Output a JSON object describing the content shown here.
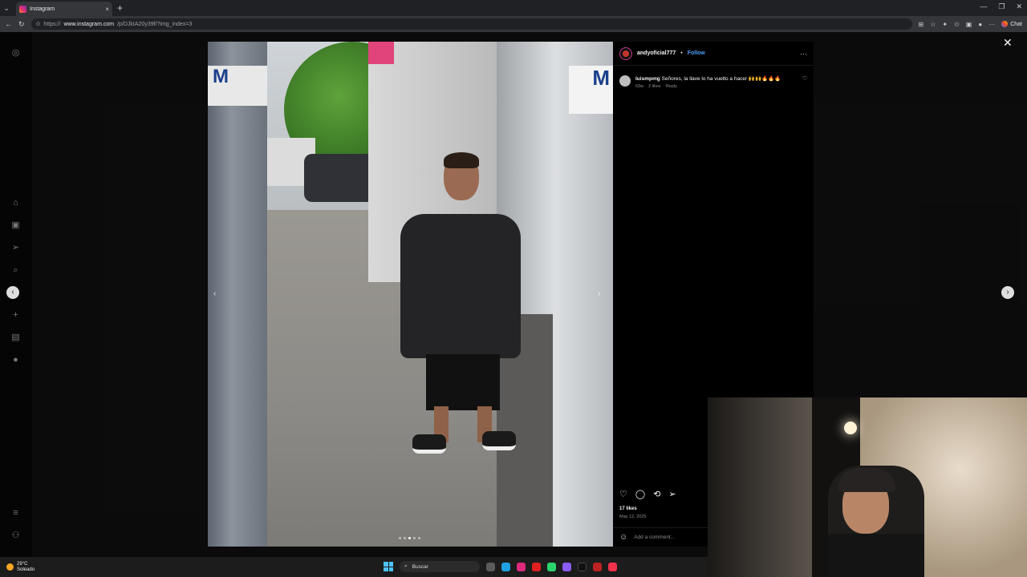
{
  "browser": {
    "tab_title": "Instagram",
    "tab_close": "×",
    "new_tab": "+",
    "url_prefix": "https://",
    "url_host": "www.instagram.com",
    "url_path": "/p/DJkIA20y39f/?img_index=3",
    "chat_label": "Chat"
  },
  "post": {
    "username": "andyoficial777",
    "separator": "•",
    "follow_label": "Follow",
    "more_label": "···",
    "likes": "17 likes",
    "date": "May 12, 2025",
    "add_comment_placeholder": "Add a comment..."
  },
  "comments": [
    {
      "user": "luismpmg",
      "text": "Señores, la llave lo ha vuelto a hacer 🙌🙌🔥🔥🔥",
      "age": "63w",
      "likes": "2 likes",
      "reply": "Reply"
    }
  ],
  "photo": {
    "left_sign": "M",
    "right_sign": "M",
    "slide_count": 5,
    "active_slide": 3
  },
  "taskbar": {
    "temp": "29°C",
    "condition": "Soleado",
    "search_label": "Buscar"
  },
  "icons": {
    "close": "✕",
    "prev": "‹",
    "next": "›"
  },
  "colors": {
    "follow": "#4f9cf6",
    "background": "#0b0b0b"
  }
}
